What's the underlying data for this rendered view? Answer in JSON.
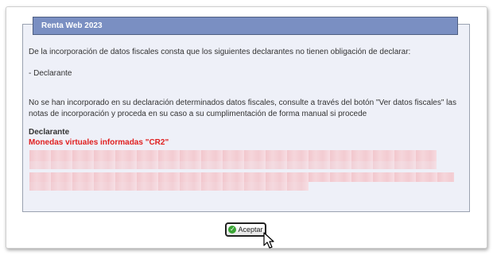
{
  "dialog": {
    "title": "Renta Web 2023",
    "intro": "De la incorporación de datos fiscales consta que los siguientes declarantes no tienen obligación de declarar:",
    "declarant_item": "- Declarante",
    "note": "No se han incorporado en su declaración determinados datos fiscales, consulte a través del botón \"Ver datos fiscales\" las notas de incorporación y proceda en su caso a su cumplimentación de forma manual si procede",
    "declarant_heading": "Declarante",
    "section_heading": "Monedas virtuales informadas \"CR2\""
  },
  "accept_button": {
    "label": "Aceptar",
    "icon": "check-circle-icon"
  },
  "colors": {
    "title_bg": "#7a8fc2",
    "panel_bg": "#eef0f8",
    "warning_text": "#e02020",
    "accept_icon": "#3aa535"
  }
}
